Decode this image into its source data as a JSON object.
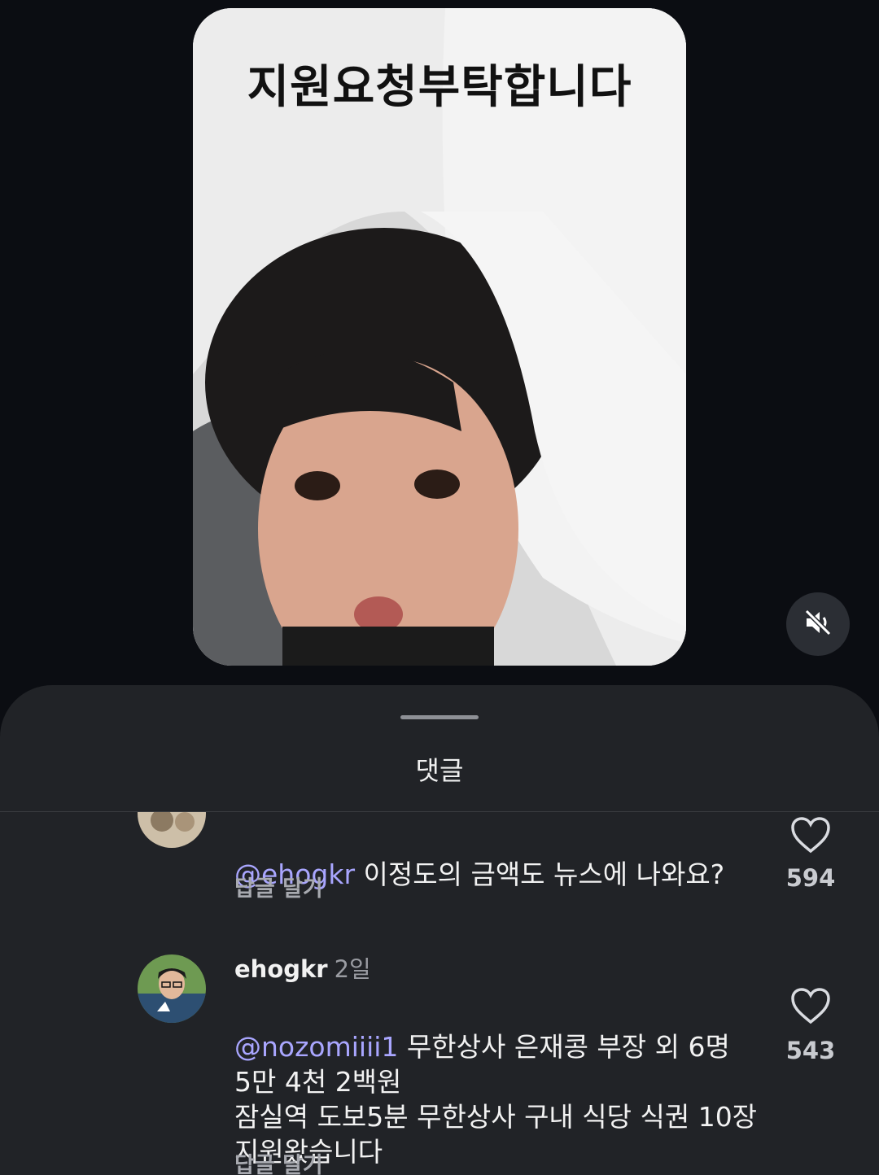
{
  "video": {
    "caption": "지원요청부탁합니다",
    "mute_icon": "speaker-muted-icon"
  },
  "sheet": {
    "title": "댓글"
  },
  "comments": [
    {
      "username": "",
      "time": "",
      "mention": "@ehogkr",
      "text": " 이정도의 금액도 뉴스에 나와요?",
      "reply_label": "답글 달기",
      "likes": "594"
    },
    {
      "username": "ehogkr",
      "time": "2일",
      "mention": "@nozomiiii1",
      "text": " 무한상사 은재콩 부장 외 6명\n5만 4천 2백원\n잠실역 도보5분 무한상사 구내 식당 식권 10장\n지원왔습니다",
      "reply_label": "답글 달기",
      "likes": "543"
    }
  ],
  "colors": {
    "background": "#0b0d12",
    "sheet": "#212327",
    "mention": "#a9a6ff"
  }
}
